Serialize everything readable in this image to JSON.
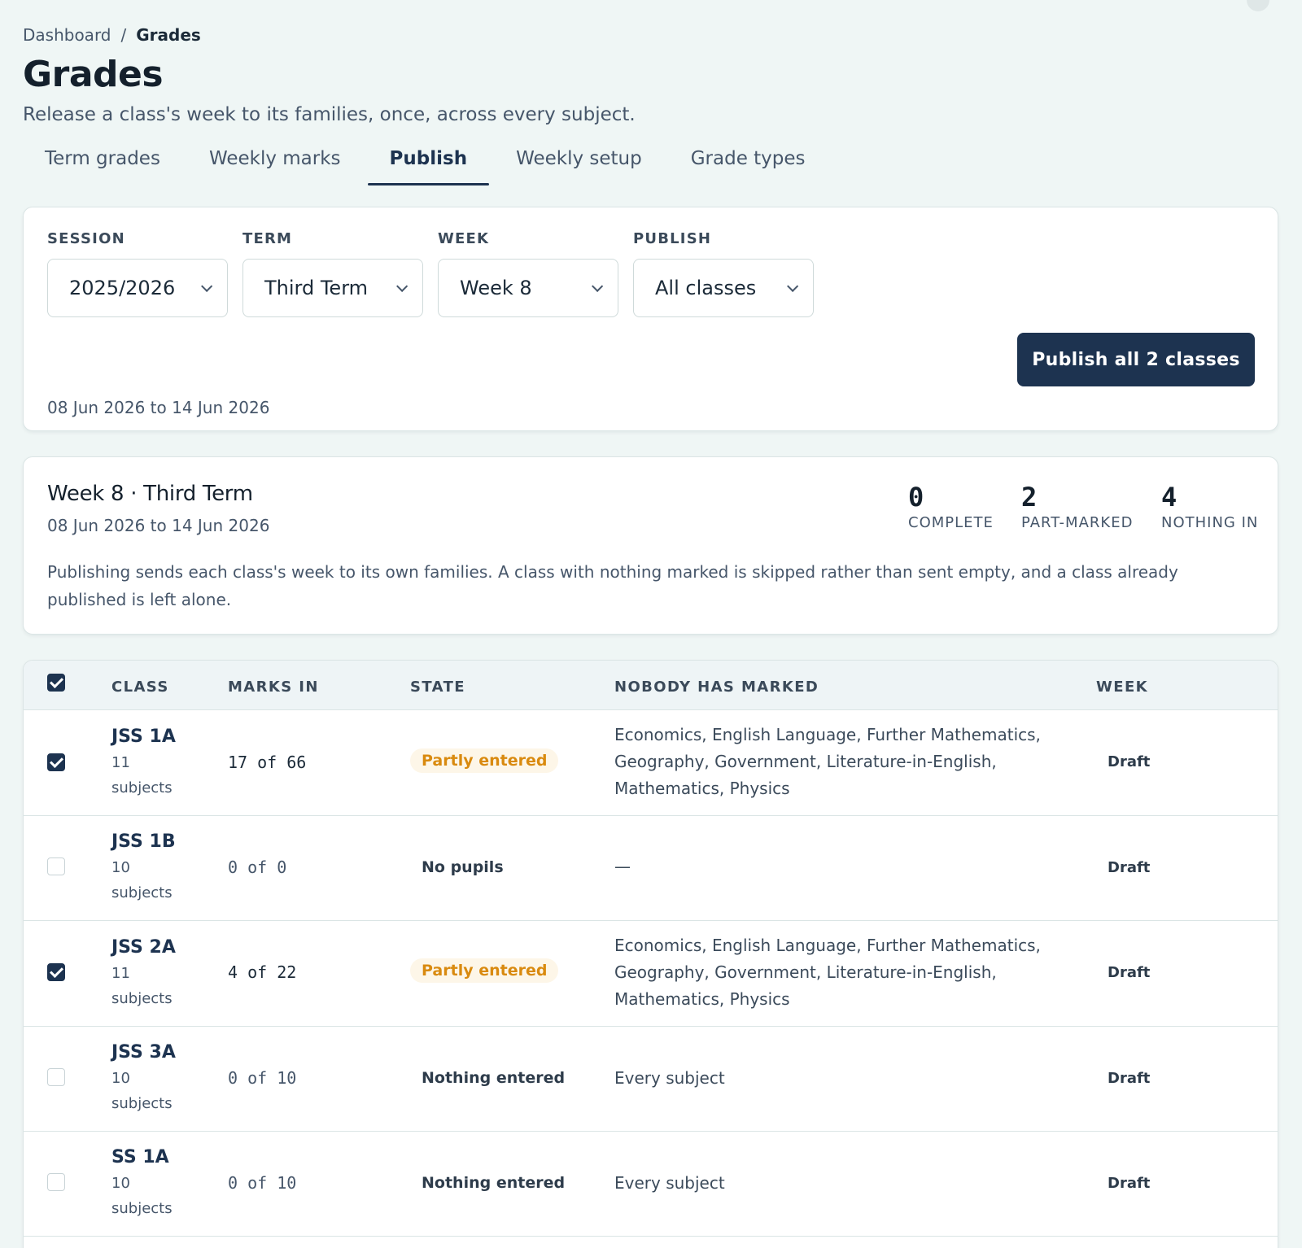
{
  "breadcrumb": {
    "root": "Dashboard",
    "separator": "/",
    "current": "Grades"
  },
  "page": {
    "title": "Grades",
    "subtitle": "Release a class's week to its families, once, across every subject."
  },
  "tabs": [
    {
      "label": "Term grades",
      "active": false
    },
    {
      "label": "Weekly marks",
      "active": false
    },
    {
      "label": "Publish",
      "active": true
    },
    {
      "label": "Weekly setup",
      "active": false
    },
    {
      "label": "Grade types",
      "active": false
    }
  ],
  "filters": {
    "session": {
      "label": "SESSION",
      "value": "2025/2026"
    },
    "term": {
      "label": "TERM",
      "value": "Third Term"
    },
    "week": {
      "label": "WEEK",
      "value": "Week 8"
    },
    "publish": {
      "label": "PUBLISH",
      "value": "All classes"
    },
    "publish_button": "Publish all 2 classes",
    "date_range": "08 Jun 2026 to 14 Jun 2026"
  },
  "summary": {
    "title": "Week 8 · Third Term",
    "dates": "08 Jun 2026 to 14 Jun 2026",
    "stats": [
      {
        "value": "0",
        "label": "COMPLETE"
      },
      {
        "value": "2",
        "label": "PART-MARKED"
      },
      {
        "value": "4",
        "label": "NOTHING IN"
      }
    ],
    "note": "Publishing sends each class's week to its own families. A class with nothing marked is skipped rather than sent empty, and a class already published is left alone."
  },
  "table": {
    "headers": {
      "class": "CLASS",
      "marks_in": "MARKS IN",
      "state": "STATE",
      "nobody": "NOBODY HAS MARKED",
      "week": "WEEK"
    },
    "header_checked": true,
    "rows": [
      {
        "checked": true,
        "name": "JSS 1A",
        "subjects": "11 subjects",
        "marks": "17 of 66",
        "state": "Partly entered",
        "nobody": "Economics, English Language, Further Mathematics, Geography, Government, Literature-in-English, Mathematics, Physics",
        "week": "Draft"
      },
      {
        "checked": false,
        "name": "JSS 1B",
        "subjects": "10 subjects",
        "marks": "0 of 0",
        "state": "No pupils",
        "nobody": "—",
        "week": "Draft"
      },
      {
        "checked": true,
        "name": "JSS 2A",
        "subjects": "11 subjects",
        "marks": "4 of 22",
        "state": "Partly entered",
        "nobody": "Economics, English Language, Further Mathematics, Geography, Government, Literature-in-English, Mathematics, Physics",
        "week": "Draft"
      },
      {
        "checked": false,
        "name": "JSS 3A",
        "subjects": "10 subjects",
        "marks": "0 of 10",
        "state": "Nothing entered",
        "nobody": "Every subject",
        "week": "Draft"
      },
      {
        "checked": false,
        "name": "SS 1A",
        "subjects": "10 subjects",
        "marks": "0 of 10",
        "state": "Nothing entered",
        "nobody": "Every subject",
        "week": "Draft"
      }
    ]
  },
  "colors": {
    "accent": "#1d3350",
    "background": "#eff6f5",
    "partly_badge_bg": "#fdf6e8",
    "partly_badge_text": "#d98a0f"
  }
}
